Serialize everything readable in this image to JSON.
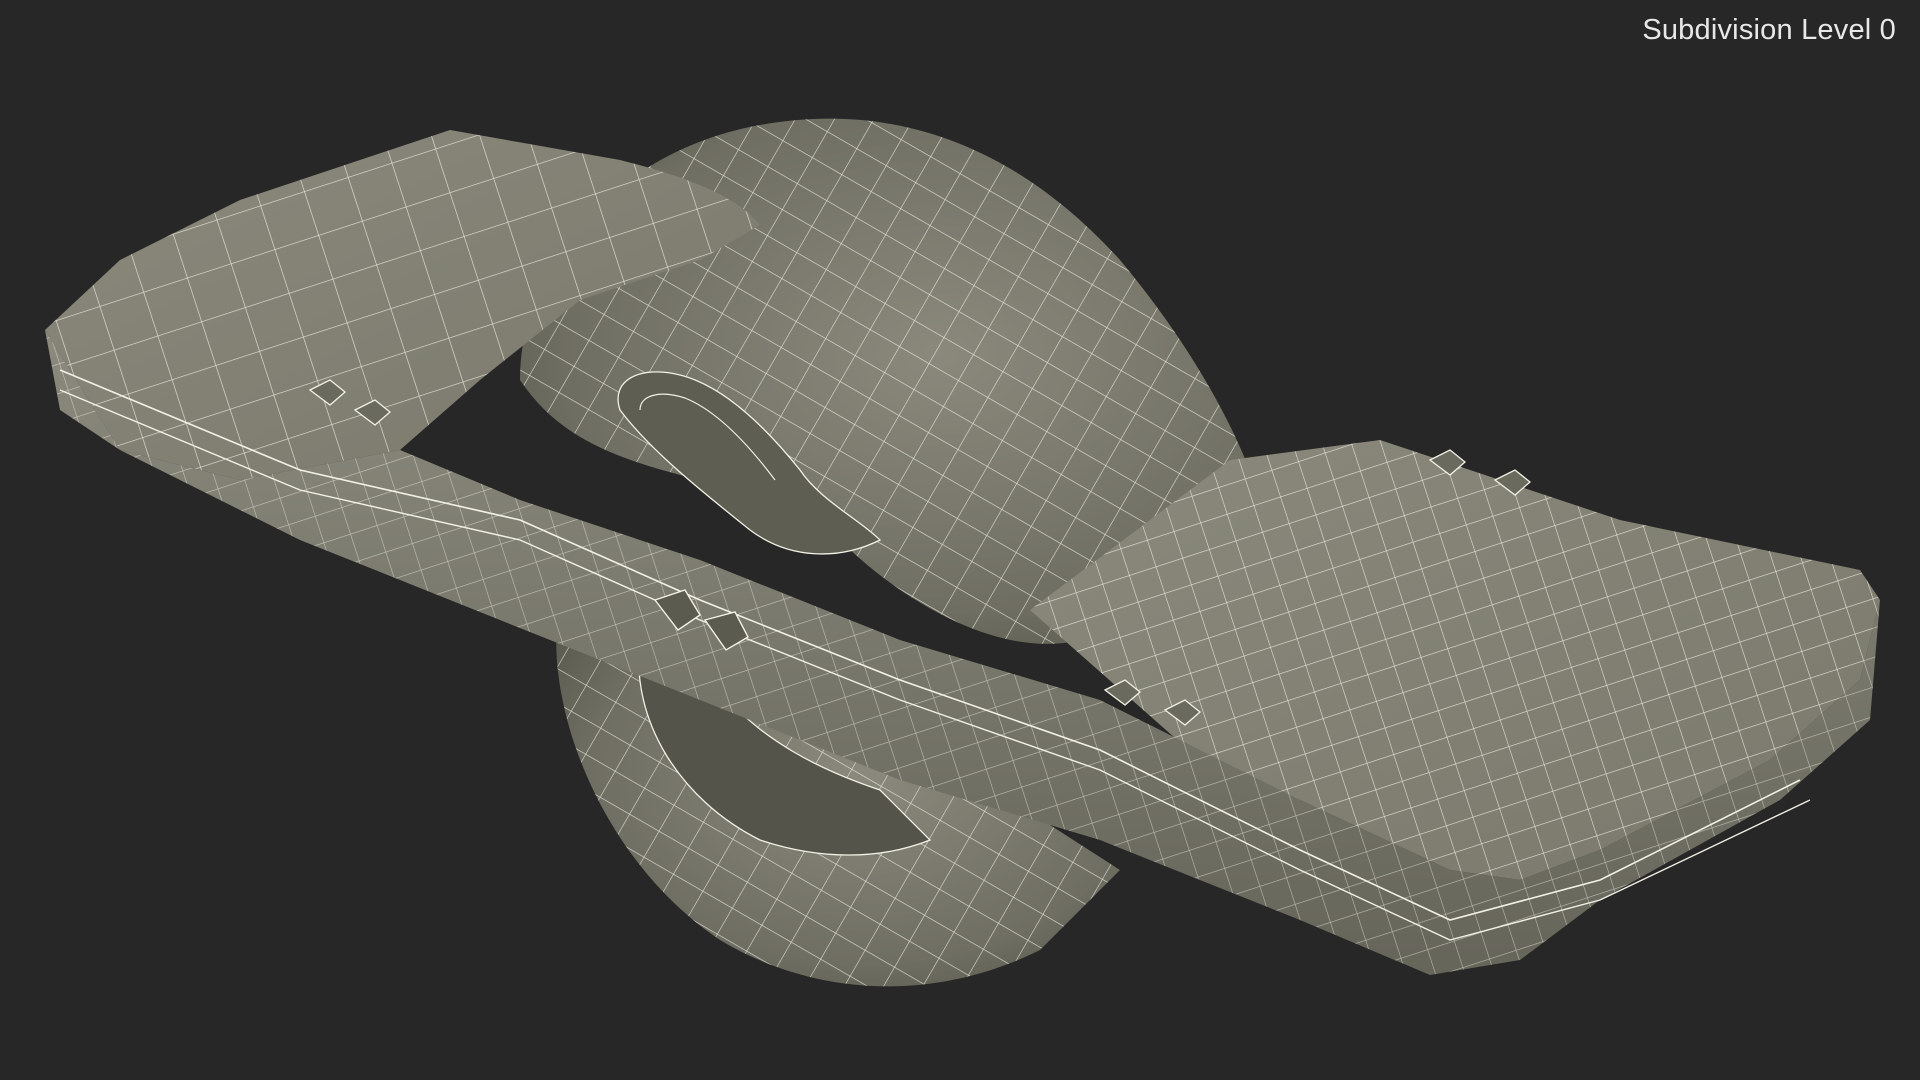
{
  "viewport": {
    "subdivision_label": "Subdivision Level 0",
    "background_color": "#272727",
    "model_fill_color": "#7c7b6e",
    "wire_color": "#f2f1e6"
  },
  "model": {
    "icon": "onewheel-wireframe-render"
  }
}
